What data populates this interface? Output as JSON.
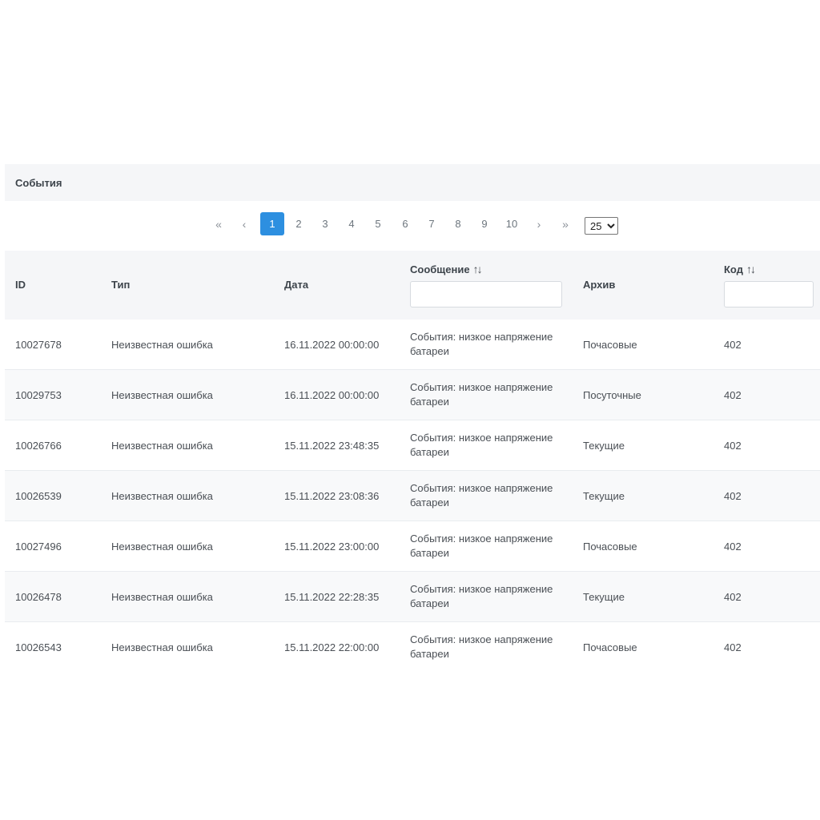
{
  "panel": {
    "title": "События"
  },
  "pagination": {
    "first_icon": "double-chevron-left-icon",
    "prev_icon": "chevron-left-icon",
    "next_icon": "chevron-right-icon",
    "last_icon": "double-chevron-right-icon",
    "pages": [
      "1",
      "2",
      "3",
      "4",
      "5",
      "6",
      "7",
      "8",
      "9",
      "10"
    ],
    "active_page": "1",
    "page_size": "25",
    "page_size_options": [
      "25"
    ],
    "active_color": "#2d8fe0"
  },
  "table": {
    "columns": {
      "id": "ID",
      "type": "Тип",
      "date": "Дата",
      "message": "Сообщение",
      "archive": "Архив",
      "code": "Код"
    },
    "sort_icon": "sort-arrows-icon",
    "message_filter": "",
    "code_filter": "",
    "rows": [
      {
        "id": "10027678",
        "type": "Неизвестная ошибка",
        "date": "16.11.2022 00:00:00",
        "message": "События: низкое напряжение батареи",
        "archive": "Почасовые",
        "code": "402"
      },
      {
        "id": "10029753",
        "type": "Неизвестная ошибка",
        "date": "16.11.2022 00:00:00",
        "message": "События: низкое напряжение батареи",
        "archive": "Посуточные",
        "code": "402"
      },
      {
        "id": "10026766",
        "type": "Неизвестная ошибка",
        "date": "15.11.2022 23:48:35",
        "message": "События: низкое напряжение батареи",
        "archive": "Текущие",
        "code": "402"
      },
      {
        "id": "10026539",
        "type": "Неизвестная ошибка",
        "date": "15.11.2022 23:08:36",
        "message": "События: низкое напряжение батареи",
        "archive": "Текущие",
        "code": "402"
      },
      {
        "id": "10027496",
        "type": "Неизвестная ошибка",
        "date": "15.11.2022 23:00:00",
        "message": "События: низкое напряжение батареи",
        "archive": "Почасовые",
        "code": "402"
      },
      {
        "id": "10026478",
        "type": "Неизвестная ошибка",
        "date": "15.11.2022 22:28:35",
        "message": "События: низкое напряжение батареи",
        "archive": "Текущие",
        "code": "402"
      },
      {
        "id": "10026543",
        "type": "Неизвестная ошибка",
        "date": "15.11.2022 22:00:00",
        "message": "События: низкое напряжение батареи",
        "archive": "Почасовые",
        "code": "402"
      }
    ]
  }
}
